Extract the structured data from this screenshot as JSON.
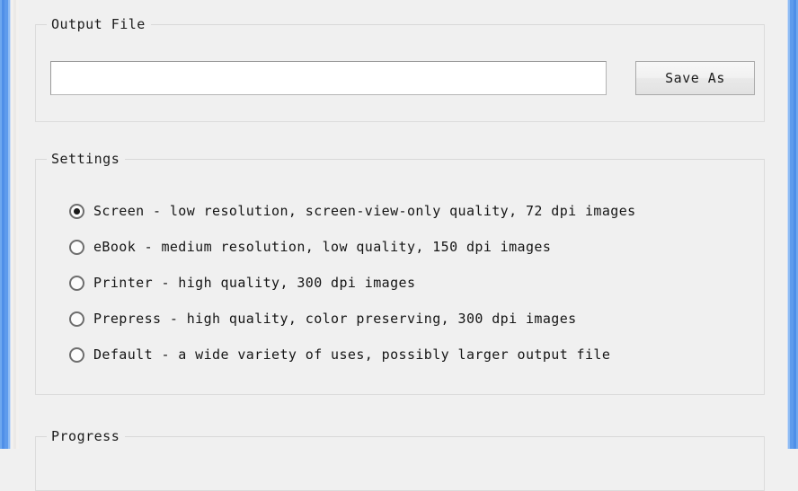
{
  "window": {
    "border_color": "#5e9bec",
    "background_color": "#f0f0f0"
  },
  "output_file": {
    "group_title": "Output File",
    "input": {
      "value": "",
      "placeholder": ""
    },
    "save_as_label": "Save As"
  },
  "settings": {
    "group_title": "Settings",
    "options": [
      {
        "label": "Screen - low resolution, screen-view-only quality, 72 dpi images",
        "selected": true
      },
      {
        "label": "eBook - medium resolution, low quality, 150 dpi images",
        "selected": false
      },
      {
        "label": "Printer - high quality, 300 dpi images",
        "selected": false
      },
      {
        "label": "Prepress - high quality, color preserving, 300 dpi images",
        "selected": false
      },
      {
        "label": "Default - a wide variety of uses, possibly larger output file",
        "selected": false
      }
    ]
  },
  "progress": {
    "group_title": "Progress"
  }
}
